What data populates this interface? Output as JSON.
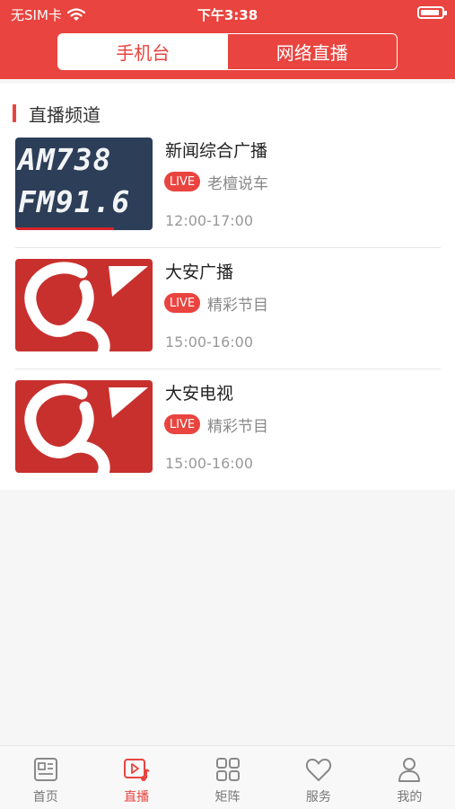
{
  "status_bar": {
    "carrier": "无SIM卡",
    "time": "下午3:38"
  },
  "segment": {
    "tabs": [
      "手机台",
      "网络直播"
    ],
    "active_index": 0
  },
  "section": {
    "title": "直播频道"
  },
  "channels": [
    {
      "name": "新闻综合广播",
      "badge": "LIVE",
      "program": "老檀说车",
      "time": "12:00-17:00",
      "thumb_text": [
        "AM738",
        "FM91.6"
      ]
    },
    {
      "name": "大安广播",
      "badge": "LIVE",
      "program": "精彩节目",
      "time": "15:00-16:00"
    },
    {
      "name": "大安电视",
      "badge": "LIVE",
      "program": "精彩节目",
      "time": "15:00-16:00"
    }
  ],
  "tabbar": {
    "items": [
      {
        "label": "首页",
        "icon": "news-icon"
      },
      {
        "label": "直播",
        "icon": "live-play-icon"
      },
      {
        "label": "矩阵",
        "icon": "grid-icon"
      },
      {
        "label": "服务",
        "icon": "heart-icon"
      },
      {
        "label": "我的",
        "icon": "user-icon"
      }
    ],
    "active_index": 1
  },
  "colors": {
    "brand": "#e9443f",
    "logo_bg": "#c8302e"
  }
}
